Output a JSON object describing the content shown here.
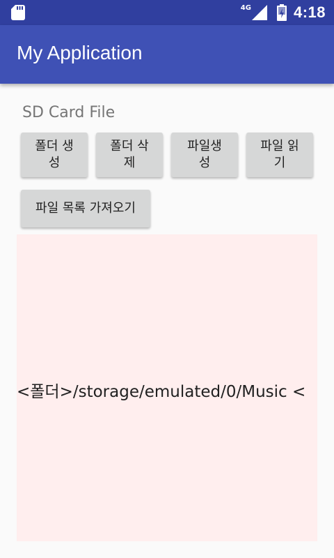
{
  "status_bar": {
    "network_label": "4G",
    "time": "4:18",
    "icons": [
      "sd-card-icon",
      "signal-icon",
      "battery-icon"
    ],
    "color": "#303f9f"
  },
  "app_bar": {
    "title": "My Application",
    "color": "#3f51b5"
  },
  "main": {
    "section_label": "SD Card File",
    "buttons": {
      "create_folder": {
        "line1": "폴더 생",
        "line2": "성"
      },
      "delete_folder": {
        "line1": "폴더 삭",
        "line2": "제"
      },
      "create_file": {
        "line1": "파일생",
        "line2": "성"
      },
      "read_file": {
        "line1": "파일 읽",
        "line2": "기"
      },
      "get_file_list": "파일 목록 가져오기"
    },
    "output_text": "<폴더>/storage/emulated/0/Music <",
    "output_background": "#ffeeee"
  }
}
